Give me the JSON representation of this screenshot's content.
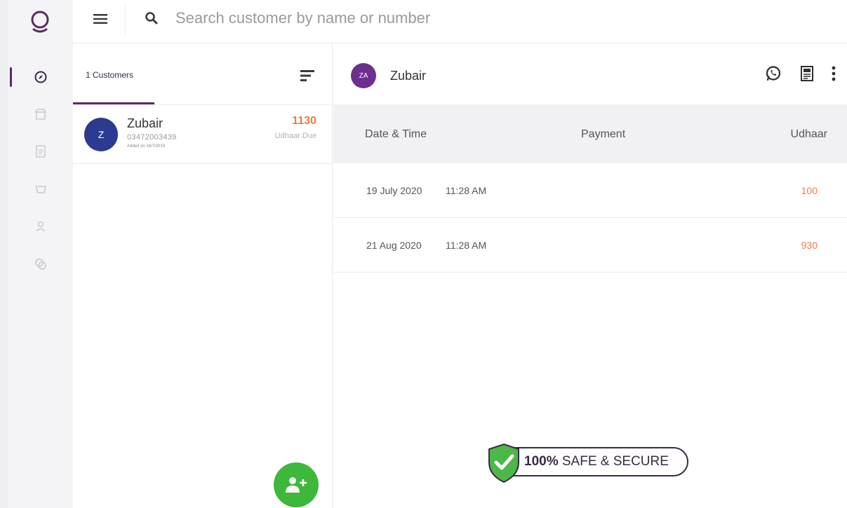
{
  "app": {
    "accent_color": "#5b2a63",
    "due_color": "#f07b3f",
    "fab_color": "#3db83a"
  },
  "sidebar": {
    "items": [
      {
        "icon": "dashboard-icon",
        "active": true
      },
      {
        "icon": "store-icon",
        "active": false
      },
      {
        "icon": "document-icon",
        "active": false
      },
      {
        "icon": "cart-icon",
        "active": false
      },
      {
        "icon": "user-icon",
        "active": false
      },
      {
        "icon": "chat-icon",
        "active": false
      }
    ]
  },
  "search": {
    "placeholder": "Search customer by name or number"
  },
  "customer_list": {
    "tab_label": "1 Customers",
    "customers": [
      {
        "initial": "Z",
        "name": "Zubair",
        "phone": "03472003439",
        "added_note": "Added on 16/7/2019",
        "amount": "1130",
        "amount_label": "Udhaar Due"
      }
    ]
  },
  "detail": {
    "initials": "ZA",
    "name": "Zubair",
    "columns": {
      "datetime": "Date & Time",
      "payment": "Payment",
      "udhaar": "Udhaar"
    },
    "transactions": [
      {
        "date": "19 July 2020",
        "time": "11:28 AM",
        "payment": "",
        "udhaar": "100"
      },
      {
        "date": "21 Aug 2020",
        "time": "11:28 AM",
        "payment": "",
        "udhaar": "930"
      }
    ],
    "badge": {
      "strong": "100%",
      "rest": " SAFE & SECURE"
    }
  }
}
